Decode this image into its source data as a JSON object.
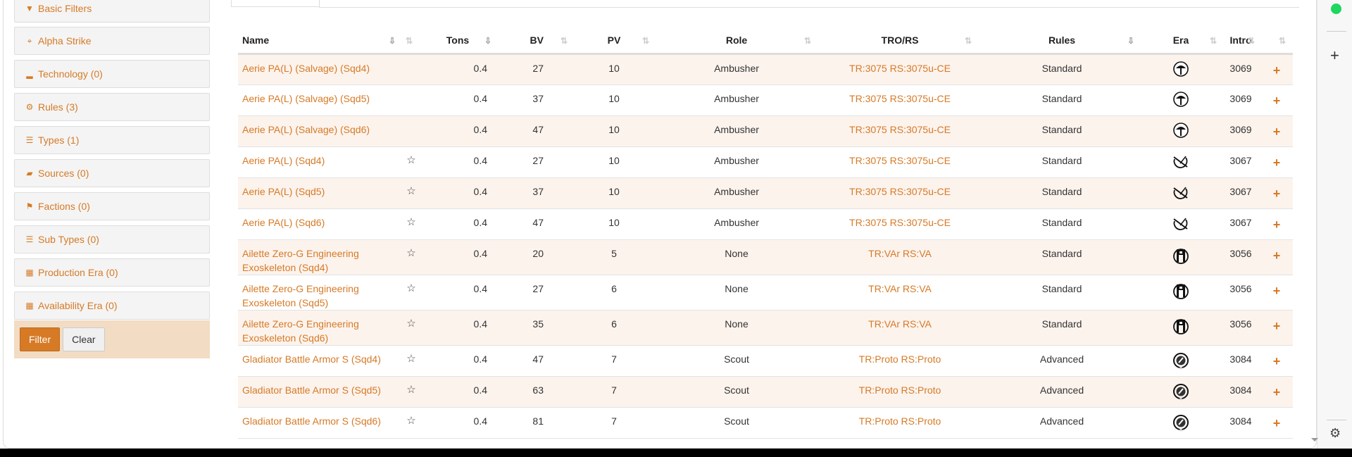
{
  "sidebar": {
    "panels": [
      {
        "label": "Basic Filters",
        "icon": "filter-icon",
        "glyph": "▼"
      },
      {
        "label": "Alpha Strike",
        "icon": "crosshairs-icon",
        "glyph": "⌖"
      },
      {
        "label": "Technology (0)",
        "icon": "signal-icon",
        "glyph": "▂"
      },
      {
        "label": "Rules (3)",
        "icon": "gear-icon",
        "glyph": "⚙"
      },
      {
        "label": "Types (1)",
        "icon": "list-icon",
        "glyph": "☰"
      },
      {
        "label": "Sources (0)",
        "icon": "book-icon",
        "glyph": "▰"
      },
      {
        "label": "Factions (0)",
        "icon": "flag-icon",
        "glyph": "⚑"
      },
      {
        "label": "Sub Types (0)",
        "icon": "list-icon",
        "glyph": "☰"
      },
      {
        "label": "Production Era (0)",
        "icon": "calendar-icon",
        "glyph": "▦"
      },
      {
        "label": "Availability Era (0)",
        "icon": "calendar-icon",
        "glyph": "▦"
      }
    ],
    "filter_label": "Filter",
    "clear_label": "Clear"
  },
  "table": {
    "headers": {
      "name": "Name",
      "tons": "Tons",
      "bv": "BV",
      "pv": "PV",
      "role": "Role",
      "tro": "TRO/RS",
      "rules": "Rules",
      "era": "Era",
      "intro": "Intro"
    },
    "rows": [
      {
        "name": "Aerie PA(L) (Salvage) (Sqd4)",
        "fav": false,
        "tons": "0.4",
        "bv": "27",
        "pv": "10",
        "role": "Ambusher",
        "tro": "TR:3075 RS:3075u-CE",
        "rules": "Standard",
        "era": "umbrella",
        "intro": "3069"
      },
      {
        "name": "Aerie PA(L) (Salvage) (Sqd5)",
        "fav": false,
        "tons": "0.4",
        "bv": "37",
        "pv": "10",
        "role": "Ambusher",
        "tro": "TR:3075 RS:3075u-CE",
        "rules": "Standard",
        "era": "umbrella",
        "intro": "3069"
      },
      {
        "name": "Aerie PA(L) (Salvage) (Sqd6)",
        "fav": false,
        "tons": "0.4",
        "bv": "47",
        "pv": "10",
        "role": "Ambusher",
        "tro": "TR:3075 RS:3075u-CE",
        "rules": "Standard",
        "era": "umbrella",
        "intro": "3069"
      },
      {
        "name": "Aerie PA(L) (Sqd4)",
        "fav": true,
        "tons": "0.4",
        "bv": "27",
        "pv": "10",
        "role": "Ambusher",
        "tro": "TR:3075 RS:3075u-CE",
        "rules": "Standard",
        "era": "sword",
        "intro": "3067"
      },
      {
        "name": "Aerie PA(L) (Sqd5)",
        "fav": true,
        "tons": "0.4",
        "bv": "37",
        "pv": "10",
        "role": "Ambusher",
        "tro": "TR:3075 RS:3075u-CE",
        "rules": "Standard",
        "era": "sword",
        "intro": "3067"
      },
      {
        "name": "Aerie PA(L) (Sqd6)",
        "fav": true,
        "tons": "0.4",
        "bv": "47",
        "pv": "10",
        "role": "Ambusher",
        "tro": "TR:3075 RS:3075u-CE",
        "rules": "Standard",
        "era": "sword",
        "intro": "3067"
      },
      {
        "name": "Ailette Zero-G Engineering Exoskeleton (Sqd4)",
        "fav": true,
        "tons": "0.4",
        "bv": "20",
        "pv": "5",
        "role": "None",
        "tro": "TR:VAr RS:VA",
        "rules": "Standard",
        "era": "mech",
        "intro": "3056"
      },
      {
        "name": "Ailette Zero-G Engineering Exoskeleton (Sqd5)",
        "fav": true,
        "tons": "0.4",
        "bv": "27",
        "pv": "6",
        "role": "None",
        "tro": "TR:VAr RS:VA",
        "rules": "Standard",
        "era": "mech",
        "intro": "3056"
      },
      {
        "name": "Ailette Zero-G Engineering Exoskeleton (Sqd6)",
        "fav": true,
        "tons": "0.4",
        "bv": "35",
        "pv": "6",
        "role": "None",
        "tro": "TR:VAr RS:VA",
        "rules": "Standard",
        "era": "mech",
        "intro": "3056"
      },
      {
        "name": "Gladiator Battle Armor S (Sqd4)",
        "fav": true,
        "tons": "0.4",
        "bv": "47",
        "pv": "7",
        "role": "Scout",
        "tro": "TR:Proto RS:Proto",
        "rules": "Advanced",
        "era": "medal",
        "intro": "3084"
      },
      {
        "name": "Gladiator Battle Armor S (Sqd5)",
        "fav": true,
        "tons": "0.4",
        "bv": "63",
        "pv": "7",
        "role": "Scout",
        "tro": "TR:Proto RS:Proto",
        "rules": "Advanced",
        "era": "medal",
        "intro": "3084"
      },
      {
        "name": "Gladiator Battle Armor S (Sqd6)",
        "fav": true,
        "tons": "0.4",
        "bv": "81",
        "pv": "7",
        "role": "Scout",
        "tro": "TR:Proto RS:Proto",
        "rules": "Advanced",
        "era": "medal",
        "intro": "3084"
      }
    ]
  },
  "colors": {
    "accent": "#d67a26",
    "row_stripe": "#fcf3ed",
    "filter_bg": "#f2dcc4",
    "spotify": "#1ed760"
  }
}
